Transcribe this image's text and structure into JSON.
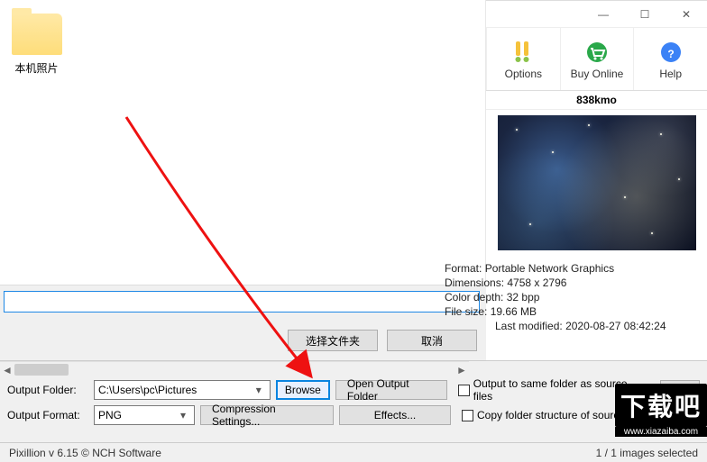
{
  "leftPanel": {
    "folderLabel": "本机照片"
  },
  "dialog": {
    "selectFolder": "选择文件夹",
    "cancel": "取消"
  },
  "window": {
    "minimize": "—",
    "maximize": "☐",
    "close": "✕"
  },
  "toolbar": {
    "options": {
      "label": "Options"
    },
    "buyOnline": {
      "label": "Buy Online"
    },
    "help": {
      "label": "Help"
    }
  },
  "preview": {
    "filename": "838kmo"
  },
  "meta": {
    "format": "Portable Network Graphics",
    "dimensions": "4758 x 2796",
    "depth": "32 bpp",
    "fileSize": "19.66 MB",
    "lastModified": "2020-08-27 08:42:24",
    "formatLabel": "Format:",
    "dimensionsLabel": "Dimensions:",
    "depthLabel": "Color depth:",
    "fileSizeLabel": "File size:",
    "lastModifiedLabel": "Last modified:"
  },
  "controls": {
    "outputFolderLabel": "Output Folder:",
    "outputFolderValue": "C:\\Users\\pc\\Pictures",
    "browse": "Browse",
    "openOutputFolder": "Open Output Folder",
    "sameFolderChk": "Output to same folder as source files",
    "outputFormatLabel": "Output Format:",
    "outputFormatValue": "PNG",
    "compressionSettings": "Compression Settings...",
    "effects": "Effects...",
    "copyStructureChk": "Copy folder structure of source files"
  },
  "status": {
    "version": "Pixillion v 6.15 © NCH Software",
    "selection": "1 / 1 images selected"
  },
  "watermark": {
    "text": "下载吧",
    "url": "www.xiazaiba.com"
  }
}
